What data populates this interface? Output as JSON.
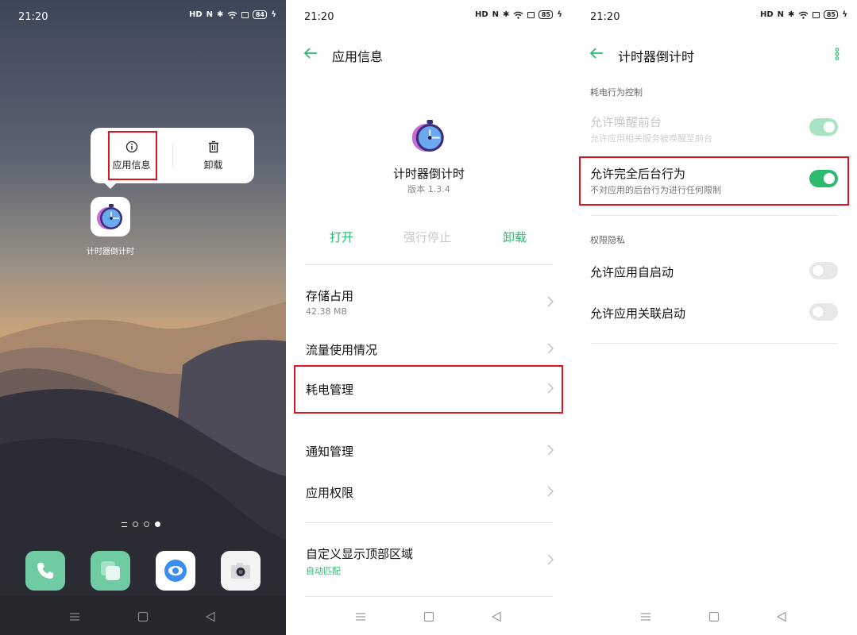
{
  "status": {
    "time": "21:20",
    "signal_text": "HD",
    "battery_p1": "84",
    "battery_p2": "85",
    "battery_p3": "85"
  },
  "home": {
    "popup": {
      "info_label": "应用信息",
      "uninstall_label": "卸载"
    },
    "app_label": "计时器倒计时",
    "page_indicator": {
      "total": 3,
      "active": 3
    },
    "dock": [
      "phone",
      "messages",
      "browser",
      "camera"
    ]
  },
  "app_info": {
    "title": "应用信息",
    "app_name": "计时器倒计时",
    "version": "版本 1.3.4",
    "actions": {
      "open": "打开",
      "force_stop": "强行停止",
      "uninstall": "卸载"
    },
    "rows": [
      {
        "label": "存储占用",
        "sub": "42.38 MB"
      },
      {
        "label": "流量使用情况"
      },
      {
        "label": "耗电管理"
      },
      {
        "label": "通知管理"
      },
      {
        "label": "应用权限"
      },
      {
        "label": "自定义显示顶部区域",
        "sub": "自动匹配"
      }
    ]
  },
  "battery": {
    "title": "计时器倒计时",
    "group1": "耗电行为控制",
    "group2": "权限隐私",
    "items": [
      {
        "label": "允许唤醒前台",
        "sub": "允许应用相关服务被唤醒至前台",
        "enabled": false,
        "on": true
      },
      {
        "label": "允许完全后台行为",
        "sub": "不对应用的后台行为进行任何限制",
        "enabled": true,
        "on": true
      },
      {
        "label": "允许应用自启动",
        "enabled": true,
        "on": false
      },
      {
        "label": "允许应用关联启动",
        "enabled": true,
        "on": false
      }
    ]
  },
  "colors": {
    "accent": "#2bba6e",
    "highlight": "#e0141e",
    "disabled": "#c8c8c8"
  }
}
